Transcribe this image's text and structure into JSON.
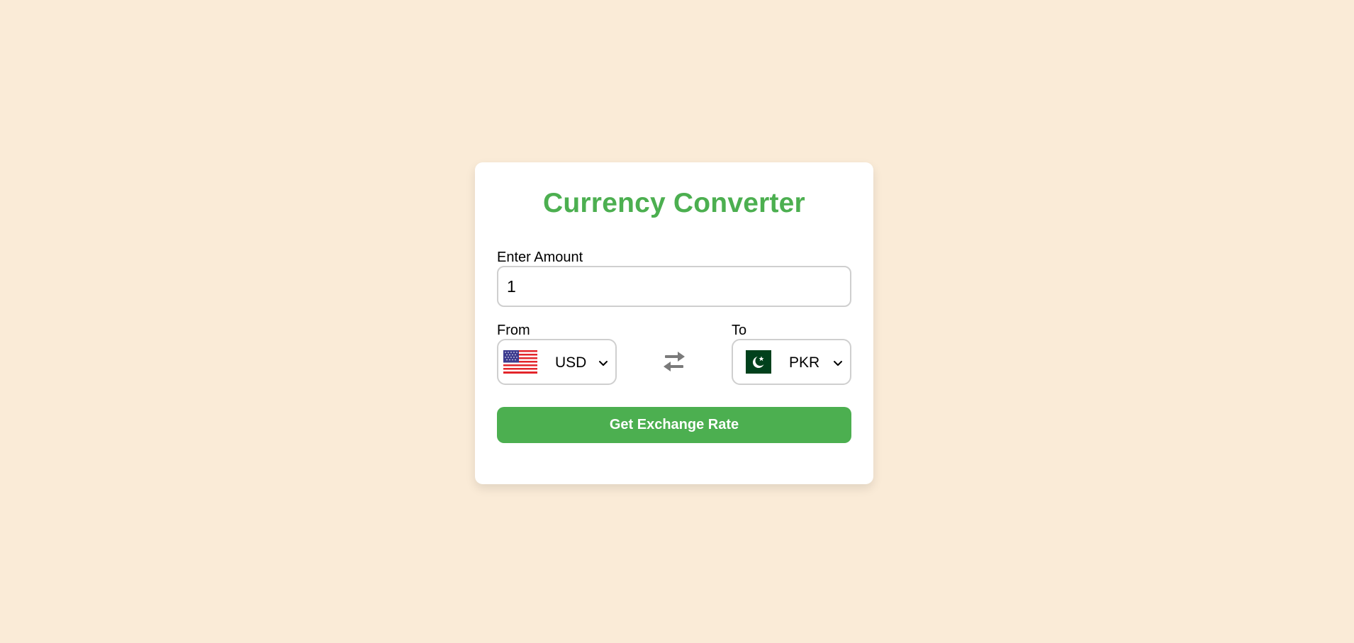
{
  "app": {
    "title": "Currency Converter"
  },
  "amount": {
    "label": "Enter Amount",
    "value": "1"
  },
  "from": {
    "label": "From",
    "currency": "USD",
    "flag": "us-flag-icon"
  },
  "to": {
    "label": "To",
    "currency": "PKR",
    "flag": "pk-flag-icon"
  },
  "swap": {
    "icon": "swap-arrows-icon"
  },
  "action": {
    "button_label": "Get Exchange Rate"
  },
  "colors": {
    "background": "#faebd7",
    "accent": "#4caf50",
    "card": "#ffffff",
    "swap_icon": "#7a7a7a"
  }
}
